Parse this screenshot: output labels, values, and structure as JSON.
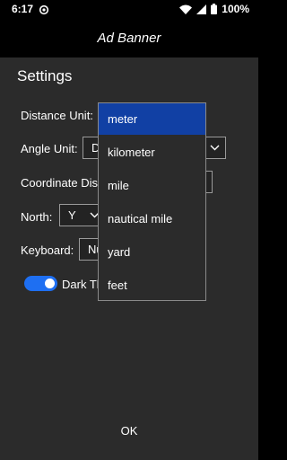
{
  "status_bar": {
    "time": "6:17",
    "battery": "100%"
  },
  "ad_banner": {
    "text": "Ad Banner"
  },
  "dialog": {
    "title": "Settings",
    "distance_label": "Distance Unit:",
    "angle_label": "Angle Unit:",
    "angle_value": "D",
    "coordinate_label": "Coordinate Disp",
    "north_label": "North:",
    "north_value": "Y",
    "keyboard_label": "Keyboard:",
    "keyboard_value": "Nu",
    "dark_theme_label": "Dark Th",
    "dark_theme_on": true,
    "ok_label": "OK"
  },
  "distance_dropdown": {
    "selected": "meter",
    "options": [
      "meter",
      "kilometer",
      "mile",
      "nautical mile",
      "yard",
      "feet"
    ]
  },
  "colors": {
    "dialog_bg": "#2b2b2b",
    "selection": "#1140a4",
    "toggle_accent": "#1e6ff2"
  }
}
